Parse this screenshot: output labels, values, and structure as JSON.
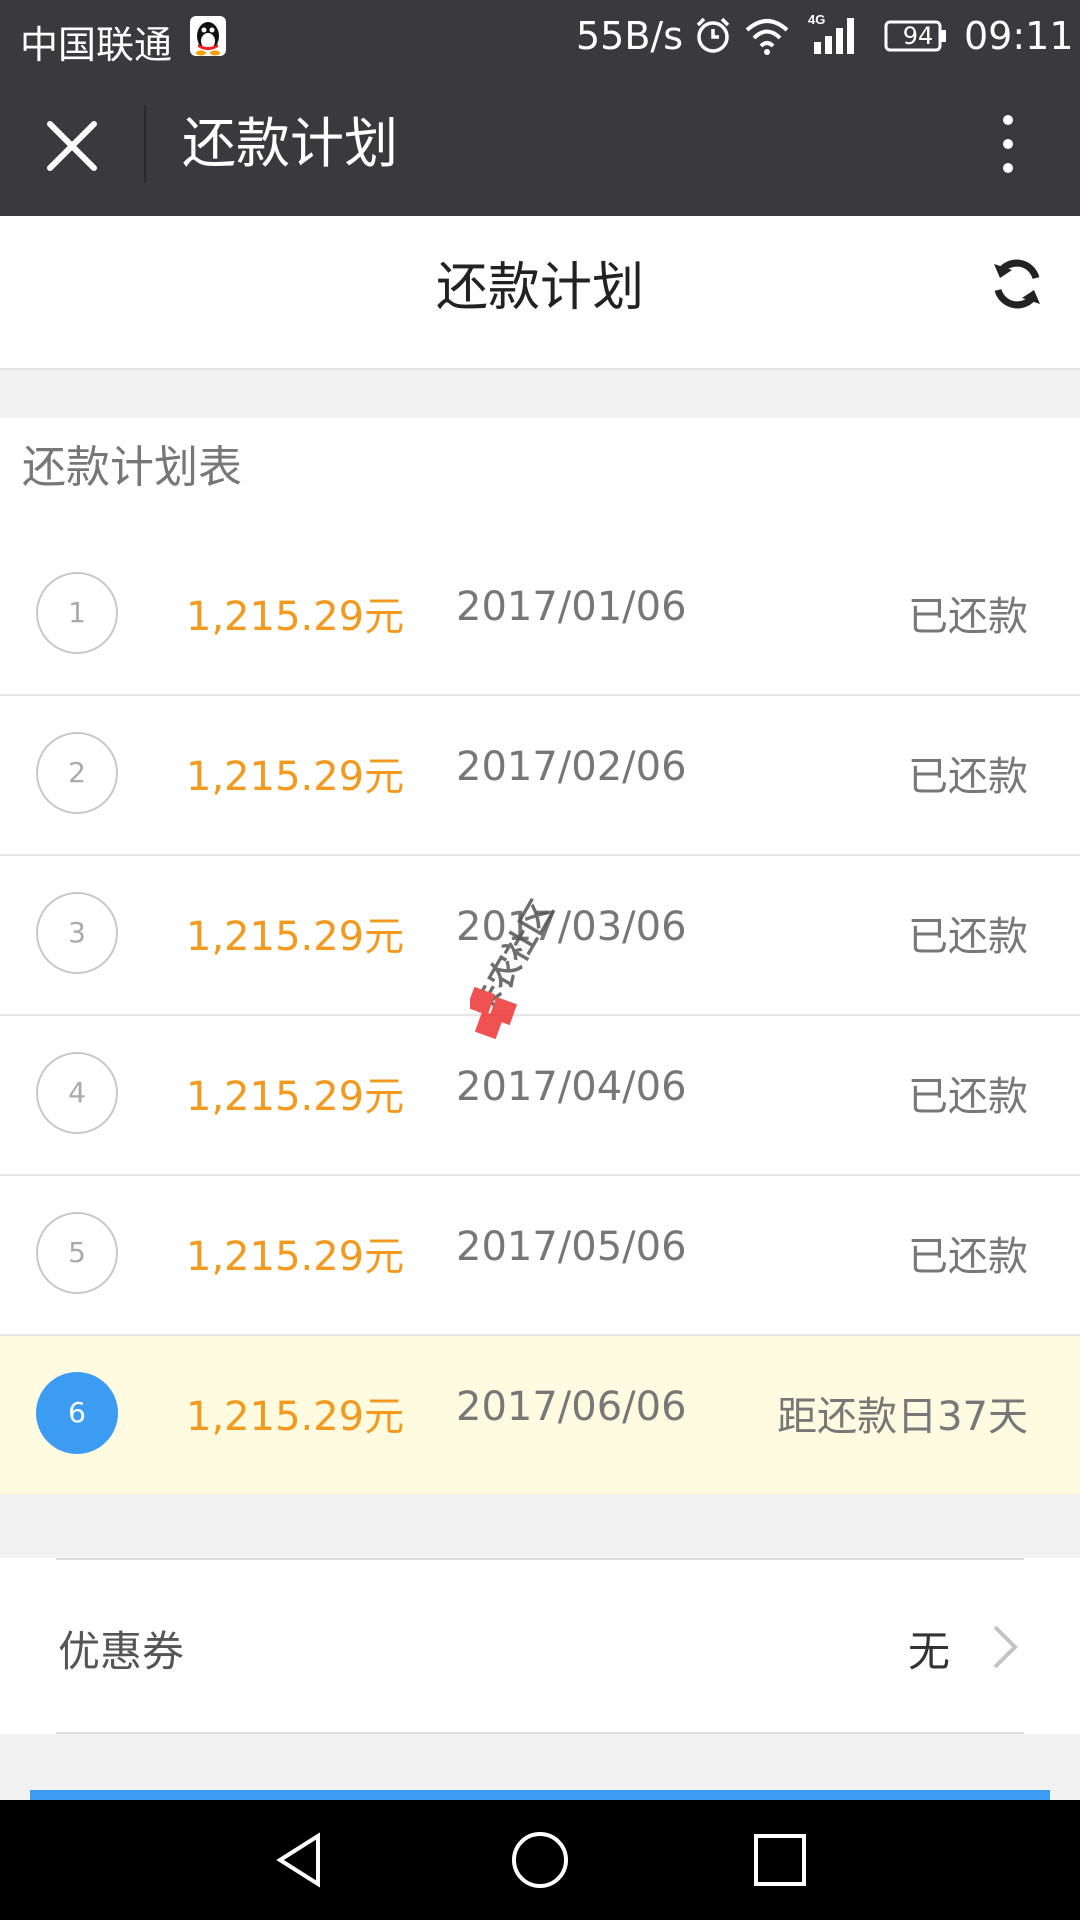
{
  "status_bar": {
    "carrier": "中国联通",
    "network_speed": "55B/s",
    "network_type": "4G",
    "battery": "94",
    "time": "09:11"
  },
  "title_bar": {
    "title": "还款计划"
  },
  "page": {
    "title": "还款计划",
    "section_title": "还款计划表"
  },
  "installments": [
    {
      "number": "1",
      "amount": "1,215.29元",
      "date": "2017/01/06",
      "status": "已还款"
    },
    {
      "number": "2",
      "amount": "1,215.29元",
      "date": "2017/02/06",
      "status": "已还款"
    },
    {
      "number": "3",
      "amount": "1,215.29元",
      "date": "2017/03/06",
      "status": "已还款"
    },
    {
      "number": "4",
      "amount": "1,215.29元",
      "date": "2017/04/06",
      "status": "已还款"
    },
    {
      "number": "5",
      "amount": "1,215.29元",
      "date": "2017/05/06",
      "status": "已还款"
    },
    {
      "number": "6",
      "amount": "1,215.29元",
      "date": "2017/06/06",
      "status": "距还款日37天"
    }
  ],
  "coupon": {
    "label": "优惠券",
    "value": "无"
  },
  "watermark": {
    "text": "卡农社区"
  },
  "colors": {
    "amount": "#f39a1e",
    "accent_blue": "#3b9cf2",
    "current_row_bg": "#fffbe0",
    "bar_bg": "#3a3a3e"
  },
  "icons": {
    "close": "close-icon",
    "more": "more-vertical-icon",
    "refresh": "refresh-icon",
    "chevron": "chevron-right-icon"
  }
}
